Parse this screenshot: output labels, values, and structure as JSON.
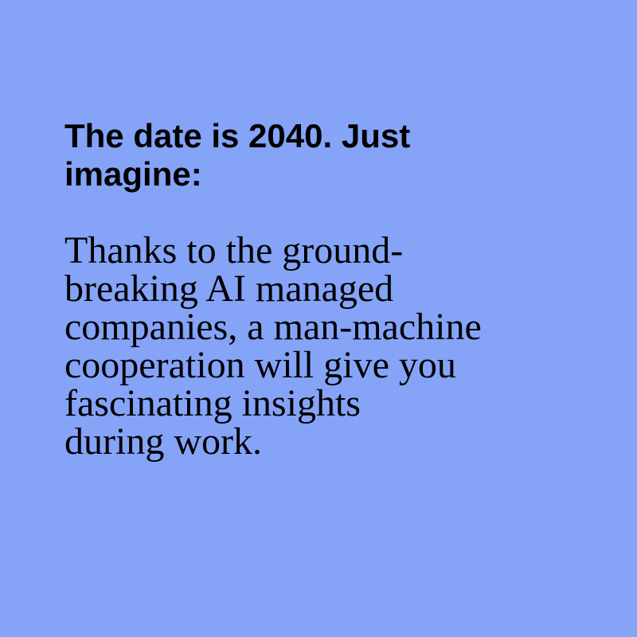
{
  "background_color": "#85a4f8",
  "text_color": "#000000",
  "headline": {
    "lines": [
      "The date is 2040. Just",
      "imagine:"
    ]
  },
  "body": {
    "lines": [
      "Thanks to the ground-",
      "breaking AI managed",
      "companies, a man-machine",
      "cooperation will give you",
      "fascinating insights",
      "during work."
    ]
  }
}
